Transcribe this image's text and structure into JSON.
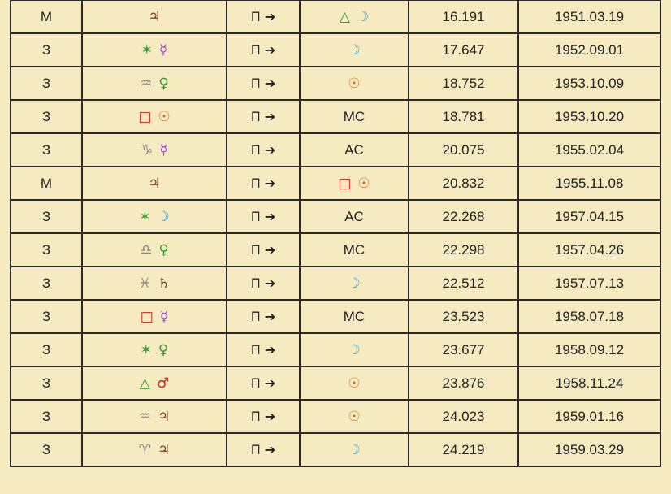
{
  "rows": [
    {
      "type": "М",
      "factor": [
        {
          "g": "♃",
          "c": "#7a3b2e"
        }
      ],
      "direction": "П ➔",
      "target": [
        {
          "g": "△",
          "c": "#2e9c2e"
        },
        {
          "g": "☽",
          "c": "#27a3e0"
        }
      ],
      "age": "16.191",
      "date": "1951.03.19"
    },
    {
      "type": "З",
      "factor": [
        {
          "g": "✶",
          "c": "#2e9c2e"
        },
        {
          "g": "☿",
          "c": "#a23fdc"
        }
      ],
      "direction": "П ➔",
      "target": [
        {
          "g": "☽",
          "c": "#27a3e0"
        }
      ],
      "age": "17.647",
      "date": "1952.09.01"
    },
    {
      "type": "З",
      "factor": [
        {
          "g": "♒",
          "c": "#8a8a8a"
        },
        {
          "g": "♀",
          "c": "#2e9c2e"
        }
      ],
      "direction": "П ➔",
      "target": [
        {
          "g": "☉",
          "c": "#e06a1a"
        }
      ],
      "age": "18.752",
      "date": "1953.10.09"
    },
    {
      "type": "З",
      "factor": [
        {
          "g": "□",
          "c": "#d02020"
        },
        {
          "g": "☉",
          "c": "#e06a1a"
        }
      ],
      "direction": "П ➔",
      "target": [
        {
          "g": "MC",
          "c": "#222"
        }
      ],
      "age": "18.781",
      "date": "1953.10.20"
    },
    {
      "type": "З",
      "factor": [
        {
          "g": "♑",
          "c": "#8a8a8a"
        },
        {
          "g": "☿",
          "c": "#a23fdc"
        }
      ],
      "direction": "П ➔",
      "target": [
        {
          "g": "AC",
          "c": "#222"
        }
      ],
      "age": "20.075",
      "date": "1955.02.04"
    },
    {
      "type": "М",
      "factor": [
        {
          "g": "♃",
          "c": "#7a3b2e"
        }
      ],
      "direction": "П ➔",
      "target": [
        {
          "g": "□",
          "c": "#d02020"
        },
        {
          "g": "☉",
          "c": "#e06a1a"
        }
      ],
      "age": "20.832",
      "date": "1955.11.08"
    },
    {
      "type": "З",
      "factor": [
        {
          "g": "✶",
          "c": "#2e9c2e"
        },
        {
          "g": "☽",
          "c": "#27a3e0"
        }
      ],
      "direction": "П ➔",
      "target": [
        {
          "g": "AC",
          "c": "#222"
        }
      ],
      "age": "22.268",
      "date": "1957.04.15"
    },
    {
      "type": "З",
      "factor": [
        {
          "g": "♎",
          "c": "#8a8a8a"
        },
        {
          "g": "♀",
          "c": "#2e9c2e"
        }
      ],
      "direction": "П ➔",
      "target": [
        {
          "g": "MC",
          "c": "#222"
        }
      ],
      "age": "22.298",
      "date": "1957.04.26"
    },
    {
      "type": "З",
      "factor": [
        {
          "g": "♓",
          "c": "#8a8a8a"
        },
        {
          "g": "♄",
          "c": "#6b3a2a"
        }
      ],
      "direction": "П ➔",
      "target": [
        {
          "g": "☽",
          "c": "#27a3e0"
        }
      ],
      "age": "22.512",
      "date": "1957.07.13"
    },
    {
      "type": "З",
      "factor": [
        {
          "g": "□",
          "c": "#d02020"
        },
        {
          "g": "☿",
          "c": "#a23fdc"
        }
      ],
      "direction": "П ➔",
      "target": [
        {
          "g": "MC",
          "c": "#222"
        }
      ],
      "age": "23.523",
      "date": "1958.07.18"
    },
    {
      "type": "З",
      "factor": [
        {
          "g": "✶",
          "c": "#2e9c2e"
        },
        {
          "g": "♀",
          "c": "#2e9c2e"
        }
      ],
      "direction": "П ➔",
      "target": [
        {
          "g": "☽",
          "c": "#27a3e0"
        }
      ],
      "age": "23.677",
      "date": "1958.09.12"
    },
    {
      "type": "З",
      "factor": [
        {
          "g": "△",
          "c": "#2e9c2e"
        },
        {
          "g": "♂",
          "c": "#d02020"
        }
      ],
      "direction": "П ➔",
      "target": [
        {
          "g": "☉",
          "c": "#e06a1a"
        }
      ],
      "age": "23.876",
      "date": "1958.11.24"
    },
    {
      "type": "З",
      "factor": [
        {
          "g": "♒",
          "c": "#8a8a8a"
        },
        {
          "g": "♃",
          "c": "#7a3b2e"
        }
      ],
      "direction": "П ➔",
      "target": [
        {
          "g": "☉",
          "c": "#e06a1a"
        }
      ],
      "age": "24.023",
      "date": "1959.01.16"
    },
    {
      "type": "З",
      "factor": [
        {
          "g": "♈",
          "c": "#8a8a8a"
        },
        {
          "g": "♃",
          "c": "#7a3b2e"
        }
      ],
      "direction": "П ➔",
      "target": [
        {
          "g": "☽",
          "c": "#27a3e0"
        }
      ],
      "age": "24.219",
      "date": "1959.03.29"
    }
  ]
}
